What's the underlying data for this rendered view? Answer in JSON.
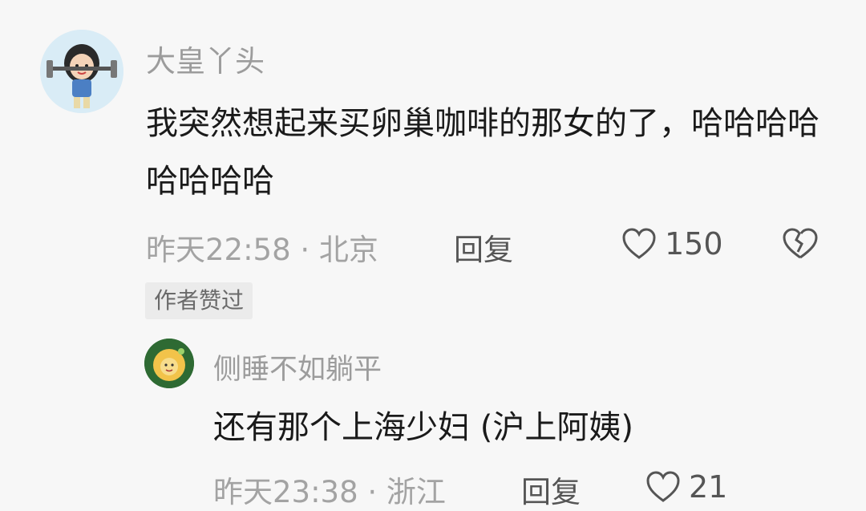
{
  "comment": {
    "username": "大皇丫头",
    "content": "我突然想起来买卵巢咖啡的那女的了，哈哈哈哈哈哈哈哈",
    "time_location": "昨天22:58 · 北京",
    "reply_label": "回复",
    "like_count": "150",
    "badge": "作者赞过"
  },
  "reply": {
    "username": "侧睡不如躺平",
    "content": "还有那个上海少妇 (沪上阿姨)",
    "time_location": "昨天23:38 · 浙江",
    "reply_label": "回复",
    "like_count": "21"
  },
  "colors": {
    "background": "#f7f7f7",
    "text_primary": "#1a1a1a",
    "text_secondary": "#9c9c9c",
    "badge_bg": "#ebebeb"
  }
}
